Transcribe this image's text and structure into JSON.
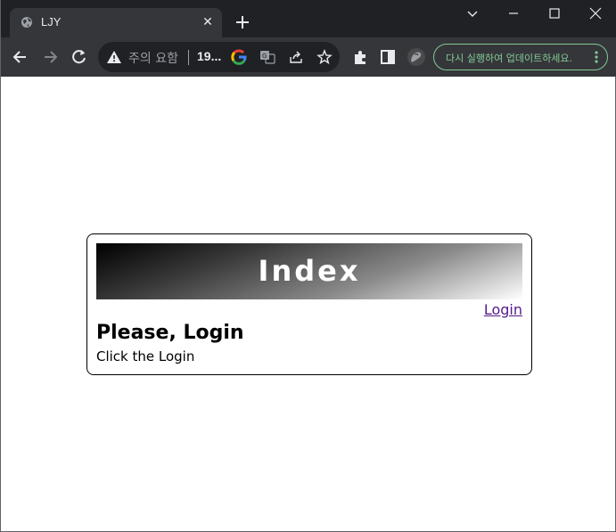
{
  "browser": {
    "tab_title": "LJY",
    "security_label": "주의 요함",
    "url": "19...",
    "update_button_label": "다시 실행하여 업데이트하세요.",
    "accent_color": "#81c995"
  },
  "page": {
    "banner_title": "Index",
    "login_link": "Login",
    "heading": "Please, Login",
    "subtext": "Click the Login"
  }
}
